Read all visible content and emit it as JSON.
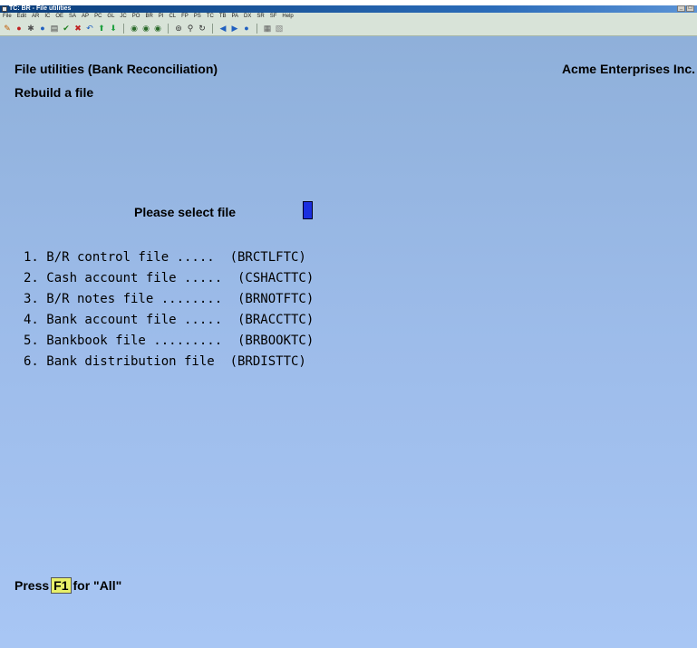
{
  "window": {
    "title": "TC: BR - File utilities",
    "controls": [
      "_",
      "□"
    ]
  },
  "menubar": [
    "File",
    "Edit",
    "AR",
    "IC",
    "OE",
    "SA",
    "AP",
    "PC",
    "GL",
    "JC",
    "PO",
    "BR",
    "PI",
    "CL",
    "FP",
    "PS",
    "TC",
    "TB",
    "PA",
    "DX",
    "SR",
    "SF",
    "Help"
  ],
  "toolbar": {
    "groups": [
      [
        {
          "icon": "launch-icon",
          "glyph": "✎",
          "color": "#c05a00"
        },
        {
          "icon": "stop-icon",
          "glyph": "●",
          "color": "#c02020"
        },
        {
          "icon": "lookup-icon",
          "glyph": "✱",
          "color": "#505050"
        },
        {
          "icon": "globe-icon",
          "glyph": "●",
          "color": "#2060c0"
        },
        {
          "icon": "print-icon",
          "glyph": "▤",
          "color": "#404040"
        },
        {
          "icon": "check-icon",
          "glyph": "✔",
          "color": "#208020"
        },
        {
          "icon": "cancel-icon",
          "glyph": "✖",
          "color": "#c02020"
        },
        {
          "icon": "undo-icon",
          "glyph": "↶",
          "color": "#2060c0"
        },
        {
          "icon": "up-arrow-icon",
          "glyph": "⬆",
          "color": "#20a040"
        },
        {
          "icon": "down-arrow-icon",
          "glyph": "⬇",
          "color": "#20a040"
        }
      ],
      [
        {
          "icon": "record-1-icon",
          "glyph": "◉",
          "color": "#2a6a2a"
        },
        {
          "icon": "record-2-icon",
          "glyph": "◉",
          "color": "#2a6a2a"
        },
        {
          "icon": "record-3-icon",
          "glyph": "◉",
          "color": "#2a6a2a"
        }
      ],
      [
        {
          "icon": "binoculars-icon",
          "glyph": "⊚",
          "color": "#303030"
        },
        {
          "icon": "zoom-icon",
          "glyph": "⚲",
          "color": "#303030"
        },
        {
          "icon": "refresh-icon",
          "glyph": "↻",
          "color": "#303030"
        }
      ],
      [
        {
          "icon": "previous-icon",
          "glyph": "◀",
          "color": "#2060c0"
        },
        {
          "icon": "next-icon",
          "glyph": "▶",
          "color": "#2060c0"
        },
        {
          "icon": "help-icon",
          "glyph": "●",
          "color": "#2060c0"
        }
      ],
      [
        {
          "icon": "calculator-icon",
          "glyph": "▦",
          "color": "#606060"
        },
        {
          "icon": "notes-icon",
          "glyph": "▧",
          "color": "#808080"
        }
      ]
    ]
  },
  "screen": {
    "title": "File utilities (Bank Reconciliation)",
    "company": "Acme Enterprises Inc.",
    "subtitle": "Rebuild a file",
    "prompt": "Please select file",
    "files": [
      "1. B/R control file .....  (BRCTLFTC)",
      "2. Cash account file .....  (CSHACTTC)",
      "3. B/R notes file ........  (BRNOTFTC)",
      "4. Bank account file .....  (BRACCTTC)",
      "5. Bankbook file .........  (BRBOOKTC)",
      "6. Bank distribution file  (BRDISTTC)"
    ],
    "footer": {
      "prefix": "Press",
      "key": "F1",
      "suffix": "for \"All\""
    }
  },
  "colors": {
    "background_top": "#8fb0da",
    "background_bottom": "#a8c6f4",
    "cursor": "#1a2fe0",
    "key_badge": "#e8f06a"
  }
}
